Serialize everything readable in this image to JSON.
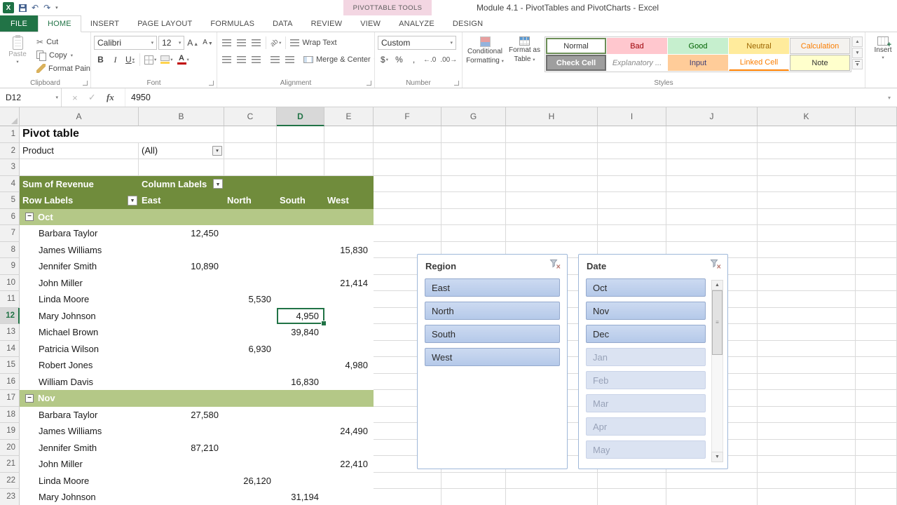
{
  "titlebar": {
    "title": "Module 4.1 - PivotTables and PivotCharts - Excel",
    "context_group": "PIVOTTABLE TOOLS"
  },
  "tabs": [
    {
      "label": "FILE",
      "type": "file"
    },
    {
      "label": "HOME",
      "type": "active"
    },
    {
      "label": "INSERT"
    },
    {
      "label": "PAGE LAYOUT"
    },
    {
      "label": "FORMULAS"
    },
    {
      "label": "DATA"
    },
    {
      "label": "REVIEW"
    },
    {
      "label": "VIEW"
    },
    {
      "label": "ANALYZE",
      "type": "contextual"
    },
    {
      "label": "DESIGN",
      "type": "contextual"
    }
  ],
  "ribbon": {
    "clipboard": {
      "label": "Clipboard",
      "paste": "Paste",
      "cut": "Cut",
      "copy": "Copy",
      "format_painter": "Format Painter"
    },
    "font": {
      "label": "Font",
      "family": "Calibri",
      "size": "12"
    },
    "alignment": {
      "label": "Alignment",
      "wrap_text": "Wrap Text",
      "merge_center": "Merge & Center"
    },
    "number": {
      "label": "Number",
      "format": "Custom"
    },
    "styles": {
      "label": "Styles",
      "conditional1": "Conditional",
      "conditional2": "Formatting",
      "table1": "Format as",
      "table2": "Table",
      "gallery": [
        {
          "label": "Normal",
          "style": "normal"
        },
        {
          "label": "Bad",
          "style": "bad"
        },
        {
          "label": "Good",
          "style": "good"
        },
        {
          "label": "Neutral",
          "style": "neutral"
        },
        {
          "label": "Calculation",
          "style": "calc"
        },
        {
          "label": "Check Cell",
          "style": "check"
        },
        {
          "label": "Explanatory ...",
          "style": "expl"
        },
        {
          "label": "Input",
          "style": "input"
        },
        {
          "label": "Linked Cell",
          "style": "linked"
        },
        {
          "label": "Note",
          "style": "note"
        }
      ]
    },
    "cells": {
      "insert": "Insert"
    }
  },
  "formula_bar": {
    "name_box": "D12",
    "formula": "4950"
  },
  "sheet": {
    "columns": [
      "A",
      "B",
      "C",
      "D",
      "E",
      "F",
      "G",
      "H",
      "I",
      "J",
      "K"
    ],
    "pivot_columns": [
      "A",
      "B",
      "C",
      "D",
      "E"
    ],
    "selected": {
      "col": "D",
      "row": 12
    },
    "rows": [
      {
        "n": 1,
        "cells": {
          "A": {
            "t": "Pivot table",
            "cls": "big-title nobr"
          }
        }
      },
      {
        "n": 2,
        "cells": {
          "A": {
            "t": "Product"
          },
          "B": {
            "t": "(All)",
            "dd": "plain"
          }
        }
      },
      {
        "n": 3
      },
      {
        "n": 4,
        "fill": "ph",
        "cells": {
          "A": {
            "t": "Sum of Revenue"
          },
          "B": {
            "t": "Column Labels",
            "dd": "white"
          }
        }
      },
      {
        "n": 5,
        "fill": "ph",
        "cells": {
          "A": {
            "t": "Row Labels",
            "dd": "filter"
          },
          "B": {
            "t": "East"
          },
          "C": {
            "t": "North"
          },
          "D": {
            "t": "South"
          },
          "E": {
            "t": "West"
          }
        }
      },
      {
        "n": 6,
        "fill": "band",
        "cells": {
          "A": {
            "t": "Oct",
            "collapse": true
          }
        }
      },
      {
        "n": 7,
        "fill": "pd",
        "cells": {
          "A": {
            "t": "Barbara Taylor",
            "cls": "ind"
          },
          "B": {
            "t": "12,450",
            "cls": "num"
          }
        }
      },
      {
        "n": 8,
        "fill": "pd",
        "cells": {
          "A": {
            "t": "James Williams",
            "cls": "ind"
          },
          "E": {
            "t": "15,830",
            "cls": "num"
          }
        }
      },
      {
        "n": 9,
        "fill": "pd",
        "cells": {
          "A": {
            "t": "Jennifer Smith",
            "cls": "ind"
          },
          "B": {
            "t": "10,890",
            "cls": "num"
          }
        }
      },
      {
        "n": 10,
        "fill": "pd",
        "cells": {
          "A": {
            "t": "John Miller",
            "cls": "ind"
          },
          "E": {
            "t": "21,414",
            "cls": "num"
          }
        }
      },
      {
        "n": 11,
        "fill": "pd",
        "cells": {
          "A": {
            "t": "Linda Moore",
            "cls": "ind"
          },
          "C": {
            "t": "5,530",
            "cls": "num"
          }
        }
      },
      {
        "n": 12,
        "fill": "pd",
        "cells": {
          "A": {
            "t": "Mary Johnson",
            "cls": "ind"
          },
          "D": {
            "t": "4,950",
            "cls": "num selcell"
          }
        }
      },
      {
        "n": 13,
        "fill": "pd",
        "cells": {
          "A": {
            "t": "Michael Brown",
            "cls": "ind"
          },
          "D": {
            "t": "39,840",
            "cls": "num"
          }
        }
      },
      {
        "n": 14,
        "fill": "pd",
        "cells": {
          "A": {
            "t": "Patricia Wilson",
            "cls": "ind"
          },
          "C": {
            "t": "6,930",
            "cls": "num"
          }
        }
      },
      {
        "n": 15,
        "fill": "pd",
        "cells": {
          "A": {
            "t": "Robert Jones",
            "cls": "ind"
          },
          "E": {
            "t": "4,980",
            "cls": "num"
          }
        }
      },
      {
        "n": 16,
        "fill": "pd",
        "cells": {
          "A": {
            "t": "William Davis",
            "cls": "ind"
          },
          "D": {
            "t": "16,830",
            "cls": "num"
          }
        }
      },
      {
        "n": 17,
        "fill": "band",
        "cells": {
          "A": {
            "t": "Nov",
            "collapse": true
          }
        }
      },
      {
        "n": 18,
        "fill": "pd",
        "cells": {
          "A": {
            "t": "Barbara Taylor",
            "cls": "ind"
          },
          "B": {
            "t": "27,580",
            "cls": "num"
          }
        }
      },
      {
        "n": 19,
        "fill": "pd",
        "cells": {
          "A": {
            "t": "James Williams",
            "cls": "ind"
          },
          "E": {
            "t": "24,490",
            "cls": "num"
          }
        }
      },
      {
        "n": 20,
        "fill": "pd",
        "cells": {
          "A": {
            "t": "Jennifer Smith",
            "cls": "ind"
          },
          "B": {
            "t": "87,210",
            "cls": "num"
          }
        }
      },
      {
        "n": 21,
        "fill": "pd",
        "cells": {
          "A": {
            "t": "John Miller",
            "cls": "ind"
          },
          "E": {
            "t": "22,410",
            "cls": "num"
          }
        }
      },
      {
        "n": 22,
        "fill": "pd",
        "cells": {
          "A": {
            "t": "Linda Moore",
            "cls": "ind"
          },
          "C": {
            "t": "26,120",
            "cls": "num"
          }
        }
      },
      {
        "n": 23,
        "fill": "pd",
        "cells": {
          "A": {
            "t": "Mary Johnson",
            "cls": "ind"
          },
          "D": {
            "t": "31,194",
            "cls": "num"
          }
        }
      }
    ]
  },
  "slicers": [
    {
      "title": "Region",
      "has_scrollbar": false,
      "items": [
        {
          "label": "East",
          "selected": true
        },
        {
          "label": "North",
          "selected": true
        },
        {
          "label": "South",
          "selected": true
        },
        {
          "label": "West",
          "selected": true
        }
      ]
    },
    {
      "title": "Date",
      "has_scrollbar": true,
      "items": [
        {
          "label": "Oct",
          "selected": true
        },
        {
          "label": "Nov",
          "selected": true
        },
        {
          "label": "Dec",
          "selected": true
        },
        {
          "label": "Jan",
          "selected": false
        },
        {
          "label": "Feb",
          "selected": false
        },
        {
          "label": "Mar",
          "selected": false
        },
        {
          "label": "Apr",
          "selected": false
        },
        {
          "label": "May",
          "selected": false
        }
      ]
    }
  ]
}
